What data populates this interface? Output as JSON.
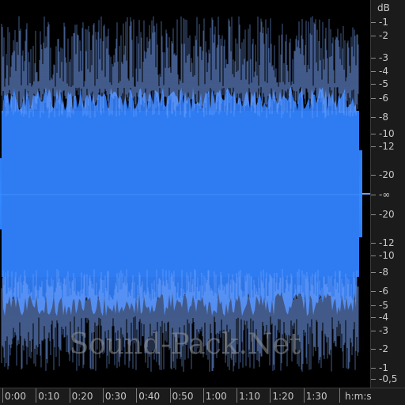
{
  "waveform": {
    "fill_color": "#2f7cf2",
    "peak_line_color": "#7aa9ff",
    "background_color": "#000000"
  },
  "db_ruler": {
    "unit": "dB",
    "labels": [
      "-1",
      "-2",
      "-3",
      "-4",
      "-5",
      "-6",
      "-8",
      "-10",
      "-12",
      "-20",
      "-∞",
      "-20",
      "-12",
      "-10",
      "-8",
      "-6",
      "-5",
      "-4",
      "-3",
      "-2",
      "-1",
      "-0,5"
    ]
  },
  "time_ruler": {
    "unit": "h:m:s",
    "labels": [
      "0:00",
      "0:10",
      "0:20",
      "0:30",
      "0:40",
      "0:50",
      "1:00",
      "1:10",
      "1:20",
      "1:30"
    ]
  },
  "watermark": "Sound-Pack.Net"
}
